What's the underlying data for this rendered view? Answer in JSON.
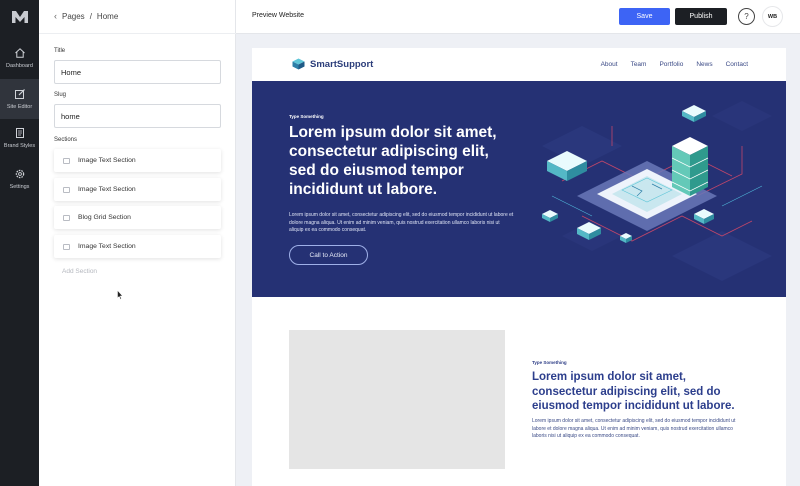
{
  "rail": {
    "logo": "M",
    "items": [
      {
        "label": "Dashboard",
        "icon": "home-icon"
      },
      {
        "label": "Site Editor",
        "icon": "edit-icon",
        "active": true
      },
      {
        "label": "Brand Styles",
        "icon": "book-icon"
      },
      {
        "label": "Settings",
        "icon": "gear-icon"
      }
    ]
  },
  "panel": {
    "breadcrumb": {
      "root": "Pages",
      "separator": "/",
      "current": "Home"
    },
    "title_label": "Title",
    "title_value": "Home",
    "slug_label": "Slug",
    "slug_value": "home",
    "sections_label": "Sections",
    "sections": [
      {
        "label": "Image Text Section"
      },
      {
        "label": "Image Text Section"
      },
      {
        "label": "Blog Grid Section"
      },
      {
        "label": "Image Text Section"
      }
    ],
    "add_section_label": "Add Section"
  },
  "topbar": {
    "title": "Preview Website",
    "save_label": "Save",
    "publish_label": "Publish",
    "help_label": "?",
    "avatar_initials": "WB"
  },
  "preview": {
    "brand_name": "SmartSupport",
    "nav": [
      "About",
      "Team",
      "Portfolio",
      "News",
      "Contact"
    ],
    "hero": {
      "eyebrow": "Type Something",
      "headline": "Lorem ipsum dolor sit amet, consectetur adipiscing elit, sed do eiusmod tempor incididunt ut labore.",
      "body": "Lorem ipsum dolor sit amet, consectetur adipiscing elit, sed do eiusmod tempor incididunt ut labore et dolore magna aliqua. Ut enim ad minim veniam, quis nostrud exercitation ullamco laboris nisi ut aliquip ex ea commodo consequat.",
      "cta_label": "Call to Action"
    },
    "section2": {
      "eyebrow": "Type Something",
      "headline": "Lorem ipsum dolor sit amet, consectetur adipiscing elit, sed do eiusmod tempor incididunt ut labore.",
      "body": "Lorem ipsum dolor sit amet, consectetur adipiscing elit, sed do eiusmod tempor incididunt ut labore et dolore magna aliqua. Ut enim ad minim veniam, quis nostrud exercitation ullamco laboris nisi ut aliquip ex ea commodo consequat."
    }
  },
  "colors": {
    "rail_bg": "#1c1f24",
    "save": "#3d64f5",
    "publish": "#1c1f24",
    "hero_bg": "#253174",
    "heading": "#2c3e8c"
  }
}
